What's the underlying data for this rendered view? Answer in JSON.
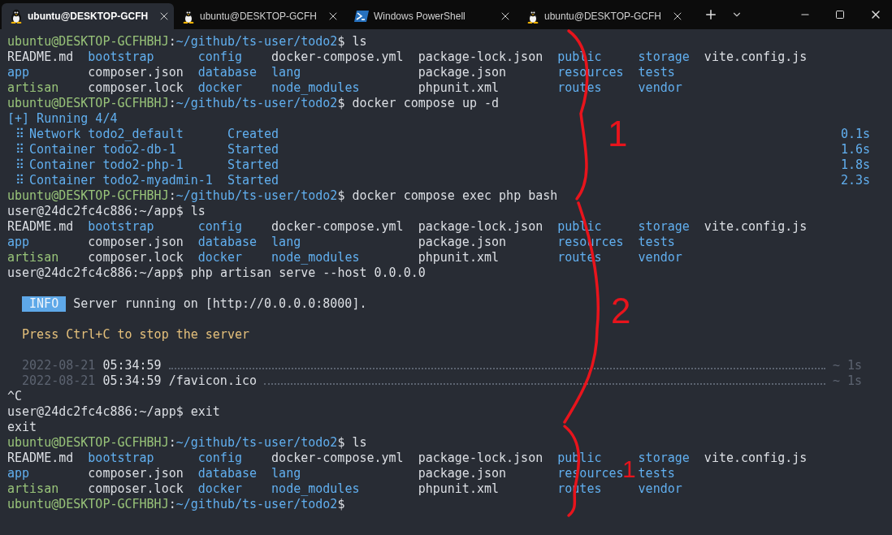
{
  "tabs": [
    {
      "kind": "linux",
      "title": "ubuntu@DESKTOP-GCFH",
      "selected": true
    },
    {
      "kind": "linux",
      "title": "ubuntu@DESKTOP-GCFH",
      "selected": false
    },
    {
      "kind": "powershell",
      "title": "Windows PowerShell",
      "selected": false
    },
    {
      "kind": "linux",
      "title": "ubuntu@DESKTOP-GCFH",
      "selected": false
    }
  ],
  "lines": [
    {
      "kind": "text",
      "segments": [
        {
          "text": "ubuntu@DESKTOP-GCFHBHJ",
          "kind": "user_host"
        },
        {
          "text": ":",
          "kind": "separator"
        },
        {
          "text": "~/github/ts-user/todo2",
          "kind": "path"
        },
        {
          "text": "$ ls",
          "kind": "command"
        }
      ]
    },
    {
      "kind": "listing",
      "entries": [
        {
          "text": "README.md",
          "kind": "file"
        },
        {
          "text": "bootstrap",
          "kind": "directory"
        },
        {
          "text": "config",
          "kind": "directory"
        },
        {
          "text": "docker-compose.yml",
          "kind": "file"
        },
        {
          "text": "package-lock.json",
          "kind": "file"
        },
        {
          "text": "public",
          "kind": "directory"
        },
        {
          "text": "storage",
          "kind": "directory"
        },
        {
          "text": "vite.config.js",
          "kind": "file"
        }
      ]
    },
    {
      "kind": "listing",
      "entries": [
        {
          "text": "app",
          "kind": "directory"
        },
        {
          "text": "composer.json",
          "kind": "file"
        },
        {
          "text": "database",
          "kind": "directory"
        },
        {
          "text": "lang",
          "kind": "directory"
        },
        {
          "text": "package.json",
          "kind": "file"
        },
        {
          "text": "resources",
          "kind": "directory"
        },
        {
          "text": "tests",
          "kind": "directory"
        }
      ]
    },
    {
      "kind": "listing",
      "entries": [
        {
          "text": "artisan",
          "kind": "executable"
        },
        {
          "text": "composer.lock",
          "kind": "file"
        },
        {
          "text": "docker",
          "kind": "directory"
        },
        {
          "text": "node_modules",
          "kind": "directory"
        },
        {
          "text": "phpunit.xml",
          "kind": "file"
        },
        {
          "text": "routes",
          "kind": "directory"
        },
        {
          "text": "vendor",
          "kind": "directory"
        }
      ]
    },
    {
      "kind": "text",
      "segments": [
        {
          "text": "ubuntu@DESKTOP-GCFHBHJ",
          "kind": "user_host"
        },
        {
          "text": ":",
          "kind": "separator"
        },
        {
          "text": "~/github/ts-user/todo2",
          "kind": "path"
        },
        {
          "text": "$ docker compose up -d",
          "kind": "command"
        }
      ]
    },
    {
      "kind": "text",
      "segments": [
        {
          "text": "[+] Running 4/4",
          "kind": "status"
        }
      ]
    },
    {
      "kind": "progress",
      "marker": "⠿",
      "name": "Network todo2_default",
      "state": "Created",
      "time": "0.1s"
    },
    {
      "kind": "progress",
      "marker": "⠿",
      "name": "Container todo2-db-1",
      "state": "Started",
      "time": "1.6s"
    },
    {
      "kind": "progress",
      "marker": "⠿",
      "name": "Container todo2-php-1",
      "state": "Started",
      "time": "1.8s"
    },
    {
      "kind": "progress",
      "marker": "⠿",
      "name": "Container todo2-myadmin-1",
      "state": "Started",
      "time": "2.3s"
    },
    {
      "kind": "text",
      "segments": [
        {
          "text": "ubuntu@DESKTOP-GCFHBHJ",
          "kind": "user_host"
        },
        {
          "text": ":",
          "kind": "separator"
        },
        {
          "text": "~/github/ts-user/todo2",
          "kind": "path"
        },
        {
          "text": "$ docker compose exec php bash",
          "kind": "command"
        }
      ]
    },
    {
      "kind": "text",
      "segments": [
        {
          "text": "user@24dc2fc4c886:~/app$ ls",
          "kind": "command"
        }
      ]
    },
    {
      "kind": "listing",
      "entries": [
        {
          "text": "README.md",
          "kind": "file"
        },
        {
          "text": "bootstrap",
          "kind": "directory"
        },
        {
          "text": "config",
          "kind": "directory"
        },
        {
          "text": "docker-compose.yml",
          "kind": "file"
        },
        {
          "text": "package-lock.json",
          "kind": "file"
        },
        {
          "text": "public",
          "kind": "directory"
        },
        {
          "text": "storage",
          "kind": "directory"
        },
        {
          "text": "vite.config.js",
          "kind": "file"
        }
      ]
    },
    {
      "kind": "listing",
      "entries": [
        {
          "text": "app",
          "kind": "directory"
        },
        {
          "text": "composer.json",
          "kind": "file"
        },
        {
          "text": "database",
          "kind": "directory"
        },
        {
          "text": "lang",
          "kind": "directory"
        },
        {
          "text": "package.json",
          "kind": "file"
        },
        {
          "text": "resources",
          "kind": "directory"
        },
        {
          "text": "tests",
          "kind": "directory"
        }
      ]
    },
    {
      "kind": "listing",
      "entries": [
        {
          "text": "artisan",
          "kind": "executable"
        },
        {
          "text": "composer.lock",
          "kind": "file"
        },
        {
          "text": "docker",
          "kind": "directory"
        },
        {
          "text": "node_modules",
          "kind": "directory"
        },
        {
          "text": "phpunit.xml",
          "kind": "file"
        },
        {
          "text": "routes",
          "kind": "directory"
        },
        {
          "text": "vendor",
          "kind": "directory"
        }
      ]
    },
    {
      "kind": "text",
      "segments": [
        {
          "text": "user@24dc2fc4c886:~/app$ php artisan serve --host 0.0.0.0",
          "kind": "command"
        }
      ]
    },
    {
      "kind": "blank"
    },
    {
      "kind": "info",
      "badge": "INFO",
      "message": "Server running on [http://0.0.0.0:8000]."
    },
    {
      "kind": "blank"
    },
    {
      "kind": "indented",
      "segments": [
        {
          "text": "Press Ctrl+C to stop the server",
          "kind": "hint"
        }
      ]
    },
    {
      "kind": "blank"
    },
    {
      "kind": "log",
      "date": "2022-08-21",
      "time": "05:34:59",
      "duration": "~ 1s"
    },
    {
      "kind": "log",
      "date": "2022-08-21",
      "time": "05:34:59",
      "path": "/favicon.ico",
      "duration": "~ 1s"
    },
    {
      "kind": "text",
      "segments": [
        {
          "text": "^C",
          "kind": "output"
        }
      ]
    },
    {
      "kind": "text",
      "segments": [
        {
          "text": "user@24dc2fc4c886:~/app$ exit",
          "kind": "command"
        }
      ]
    },
    {
      "kind": "text",
      "segments": [
        {
          "text": "exit",
          "kind": "output"
        }
      ]
    },
    {
      "kind": "text",
      "segments": [
        {
          "text": "ubuntu@DESKTOP-GCFHBHJ",
          "kind": "user_host"
        },
        {
          "text": ":",
          "kind": "separator"
        },
        {
          "text": "~/github/ts-user/todo2",
          "kind": "path"
        },
        {
          "text": "$ ls",
          "kind": "command"
        }
      ]
    },
    {
      "kind": "listing",
      "entries": [
        {
          "text": "README.md",
          "kind": "file"
        },
        {
          "text": "bootstrap",
          "kind": "directory"
        },
        {
          "text": "config",
          "kind": "directory"
        },
        {
          "text": "docker-compose.yml",
          "kind": "file"
        },
        {
          "text": "package-lock.json",
          "kind": "file"
        },
        {
          "text": "public",
          "kind": "directory"
        },
        {
          "text": "storage",
          "kind": "directory"
        },
        {
          "text": "vite.config.js",
          "kind": "file"
        }
      ]
    },
    {
      "kind": "listing",
      "entries": [
        {
          "text": "app",
          "kind": "directory"
        },
        {
          "text": "composer.json",
          "kind": "file"
        },
        {
          "text": "database",
          "kind": "directory"
        },
        {
          "text": "lang",
          "kind": "directory"
        },
        {
          "text": "package.json",
          "kind": "file"
        },
        {
          "text": "resources",
          "kind": "directory"
        },
        {
          "text": "tests",
          "kind": "directory"
        }
      ]
    },
    {
      "kind": "listing",
      "entries": [
        {
          "text": "artisan",
          "kind": "executable"
        },
        {
          "text": "composer.lock",
          "kind": "file"
        },
        {
          "text": "docker",
          "kind": "directory"
        },
        {
          "text": "node_modules",
          "kind": "directory"
        },
        {
          "text": "phpunit.xml",
          "kind": "file"
        },
        {
          "text": "routes",
          "kind": "directory"
        },
        {
          "text": "vendor",
          "kind": "directory"
        }
      ]
    },
    {
      "kind": "text",
      "segments": [
        {
          "text": "ubuntu@DESKTOP-GCFHBHJ",
          "kind": "user_host"
        },
        {
          "text": ":",
          "kind": "separator"
        },
        {
          "text": "~/github/ts-user/todo2",
          "kind": "path"
        },
        {
          "text": "$",
          "kind": "command"
        }
      ]
    }
  ],
  "annotations": [
    {
      "label": "1"
    },
    {
      "label": "2"
    },
    {
      "label": "1"
    }
  ]
}
